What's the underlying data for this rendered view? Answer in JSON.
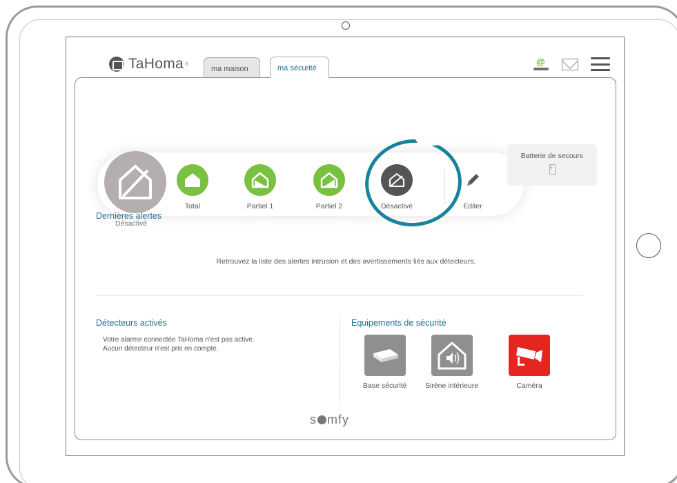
{
  "header": {
    "logo_text": "TaHoma",
    "logo_reg": "®",
    "tabs": [
      {
        "label": "ma maison",
        "active": false
      },
      {
        "label": "ma sécurité",
        "active": true
      }
    ],
    "icons": [
      "at-user-icon",
      "mail-icon",
      "menu-icon"
    ]
  },
  "modes": {
    "current_label": "Désactivé",
    "items": [
      {
        "label": "Total",
        "color": "#7ac142",
        "icon": "house-full-icon"
      },
      {
        "label": "Partiel 1",
        "color": "#7ac142",
        "icon": "house-partial1-icon"
      },
      {
        "label": "Partiel 2",
        "color": "#7ac142",
        "icon": "house-partial2-icon"
      },
      {
        "label": "Désactivé",
        "color": "#555555",
        "icon": "house-disabled-icon"
      },
      {
        "label": "Editer",
        "icon": "pencil-icon"
      }
    ]
  },
  "battery": {
    "label": "Batterie de secours",
    "icon": "battery-icon"
  },
  "alerts": {
    "title": "Dernières alertes",
    "text": "Retrouvez la liste des alertes intrusion et des avertissements liés aux détecteurs."
  },
  "detectors": {
    "title": "Détecteurs activés",
    "line1": "Votre alarme connectée TaHoma n'est pas active.",
    "line2": "Aucun détecteur n'est pris en compte."
  },
  "equipment": {
    "title": "Equipements de sécurité",
    "items": [
      {
        "label": "Base sécurité",
        "color": "#8f8f8f",
        "icon": "security-base-icon"
      },
      {
        "label": "Sirène intérieure",
        "color": "#8f8f8f",
        "icon": "siren-icon"
      },
      {
        "label": "Caméra",
        "color": "#e52620",
        "icon": "camera-icon"
      }
    ]
  },
  "footer": {
    "brand_prefix": "s",
    "brand_suffix": "mfy"
  },
  "colors": {
    "accent_green": "#7ac142",
    "link_blue": "#1f6f9a",
    "focus_ring": "#17849a",
    "camera_red": "#e52620"
  }
}
